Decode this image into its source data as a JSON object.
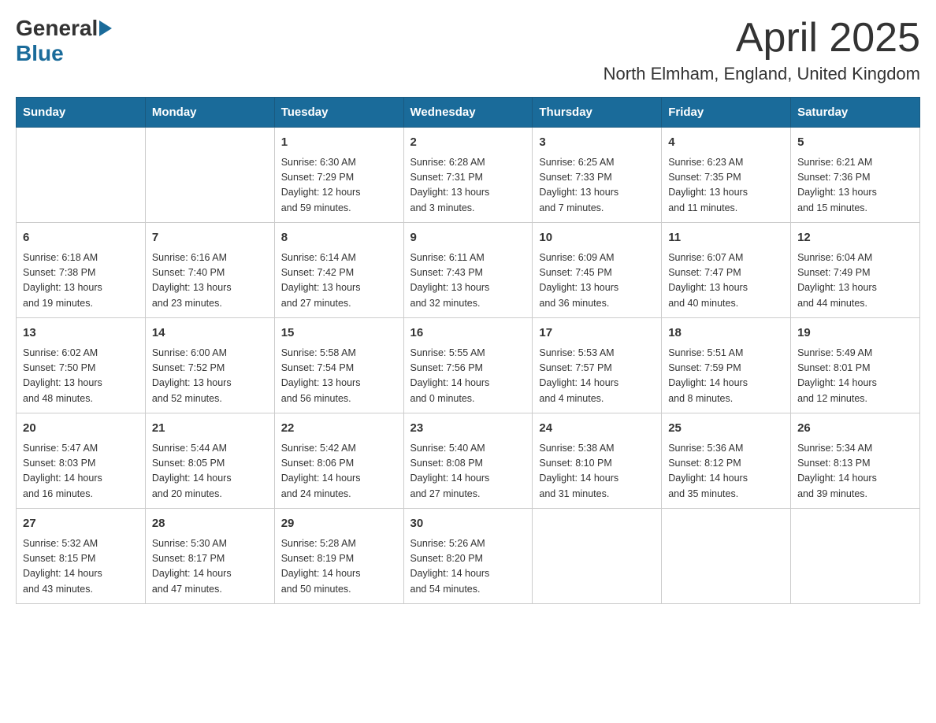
{
  "header": {
    "logo_general": "General",
    "logo_blue": "Blue",
    "main_title": "April 2025",
    "subtitle": "North Elmham, England, United Kingdom"
  },
  "calendar": {
    "days_of_week": [
      "Sunday",
      "Monday",
      "Tuesday",
      "Wednesday",
      "Thursday",
      "Friday",
      "Saturday"
    ],
    "weeks": [
      [
        {
          "day": "",
          "info": ""
        },
        {
          "day": "",
          "info": ""
        },
        {
          "day": "1",
          "info": "Sunrise: 6:30 AM\nSunset: 7:29 PM\nDaylight: 12 hours\nand 59 minutes."
        },
        {
          "day": "2",
          "info": "Sunrise: 6:28 AM\nSunset: 7:31 PM\nDaylight: 13 hours\nand 3 minutes."
        },
        {
          "day": "3",
          "info": "Sunrise: 6:25 AM\nSunset: 7:33 PM\nDaylight: 13 hours\nand 7 minutes."
        },
        {
          "day": "4",
          "info": "Sunrise: 6:23 AM\nSunset: 7:35 PM\nDaylight: 13 hours\nand 11 minutes."
        },
        {
          "day": "5",
          "info": "Sunrise: 6:21 AM\nSunset: 7:36 PM\nDaylight: 13 hours\nand 15 minutes."
        }
      ],
      [
        {
          "day": "6",
          "info": "Sunrise: 6:18 AM\nSunset: 7:38 PM\nDaylight: 13 hours\nand 19 minutes."
        },
        {
          "day": "7",
          "info": "Sunrise: 6:16 AM\nSunset: 7:40 PM\nDaylight: 13 hours\nand 23 minutes."
        },
        {
          "day": "8",
          "info": "Sunrise: 6:14 AM\nSunset: 7:42 PM\nDaylight: 13 hours\nand 27 minutes."
        },
        {
          "day": "9",
          "info": "Sunrise: 6:11 AM\nSunset: 7:43 PM\nDaylight: 13 hours\nand 32 minutes."
        },
        {
          "day": "10",
          "info": "Sunrise: 6:09 AM\nSunset: 7:45 PM\nDaylight: 13 hours\nand 36 minutes."
        },
        {
          "day": "11",
          "info": "Sunrise: 6:07 AM\nSunset: 7:47 PM\nDaylight: 13 hours\nand 40 minutes."
        },
        {
          "day": "12",
          "info": "Sunrise: 6:04 AM\nSunset: 7:49 PM\nDaylight: 13 hours\nand 44 minutes."
        }
      ],
      [
        {
          "day": "13",
          "info": "Sunrise: 6:02 AM\nSunset: 7:50 PM\nDaylight: 13 hours\nand 48 minutes."
        },
        {
          "day": "14",
          "info": "Sunrise: 6:00 AM\nSunset: 7:52 PM\nDaylight: 13 hours\nand 52 minutes."
        },
        {
          "day": "15",
          "info": "Sunrise: 5:58 AM\nSunset: 7:54 PM\nDaylight: 13 hours\nand 56 minutes."
        },
        {
          "day": "16",
          "info": "Sunrise: 5:55 AM\nSunset: 7:56 PM\nDaylight: 14 hours\nand 0 minutes."
        },
        {
          "day": "17",
          "info": "Sunrise: 5:53 AM\nSunset: 7:57 PM\nDaylight: 14 hours\nand 4 minutes."
        },
        {
          "day": "18",
          "info": "Sunrise: 5:51 AM\nSunset: 7:59 PM\nDaylight: 14 hours\nand 8 minutes."
        },
        {
          "day": "19",
          "info": "Sunrise: 5:49 AM\nSunset: 8:01 PM\nDaylight: 14 hours\nand 12 minutes."
        }
      ],
      [
        {
          "day": "20",
          "info": "Sunrise: 5:47 AM\nSunset: 8:03 PM\nDaylight: 14 hours\nand 16 minutes."
        },
        {
          "day": "21",
          "info": "Sunrise: 5:44 AM\nSunset: 8:05 PM\nDaylight: 14 hours\nand 20 minutes."
        },
        {
          "day": "22",
          "info": "Sunrise: 5:42 AM\nSunset: 8:06 PM\nDaylight: 14 hours\nand 24 minutes."
        },
        {
          "day": "23",
          "info": "Sunrise: 5:40 AM\nSunset: 8:08 PM\nDaylight: 14 hours\nand 27 minutes."
        },
        {
          "day": "24",
          "info": "Sunrise: 5:38 AM\nSunset: 8:10 PM\nDaylight: 14 hours\nand 31 minutes."
        },
        {
          "day": "25",
          "info": "Sunrise: 5:36 AM\nSunset: 8:12 PM\nDaylight: 14 hours\nand 35 minutes."
        },
        {
          "day": "26",
          "info": "Sunrise: 5:34 AM\nSunset: 8:13 PM\nDaylight: 14 hours\nand 39 minutes."
        }
      ],
      [
        {
          "day": "27",
          "info": "Sunrise: 5:32 AM\nSunset: 8:15 PM\nDaylight: 14 hours\nand 43 minutes."
        },
        {
          "day": "28",
          "info": "Sunrise: 5:30 AM\nSunset: 8:17 PM\nDaylight: 14 hours\nand 47 minutes."
        },
        {
          "day": "29",
          "info": "Sunrise: 5:28 AM\nSunset: 8:19 PM\nDaylight: 14 hours\nand 50 minutes."
        },
        {
          "day": "30",
          "info": "Sunrise: 5:26 AM\nSunset: 8:20 PM\nDaylight: 14 hours\nand 54 minutes."
        },
        {
          "day": "",
          "info": ""
        },
        {
          "day": "",
          "info": ""
        },
        {
          "day": "",
          "info": ""
        }
      ]
    ]
  }
}
